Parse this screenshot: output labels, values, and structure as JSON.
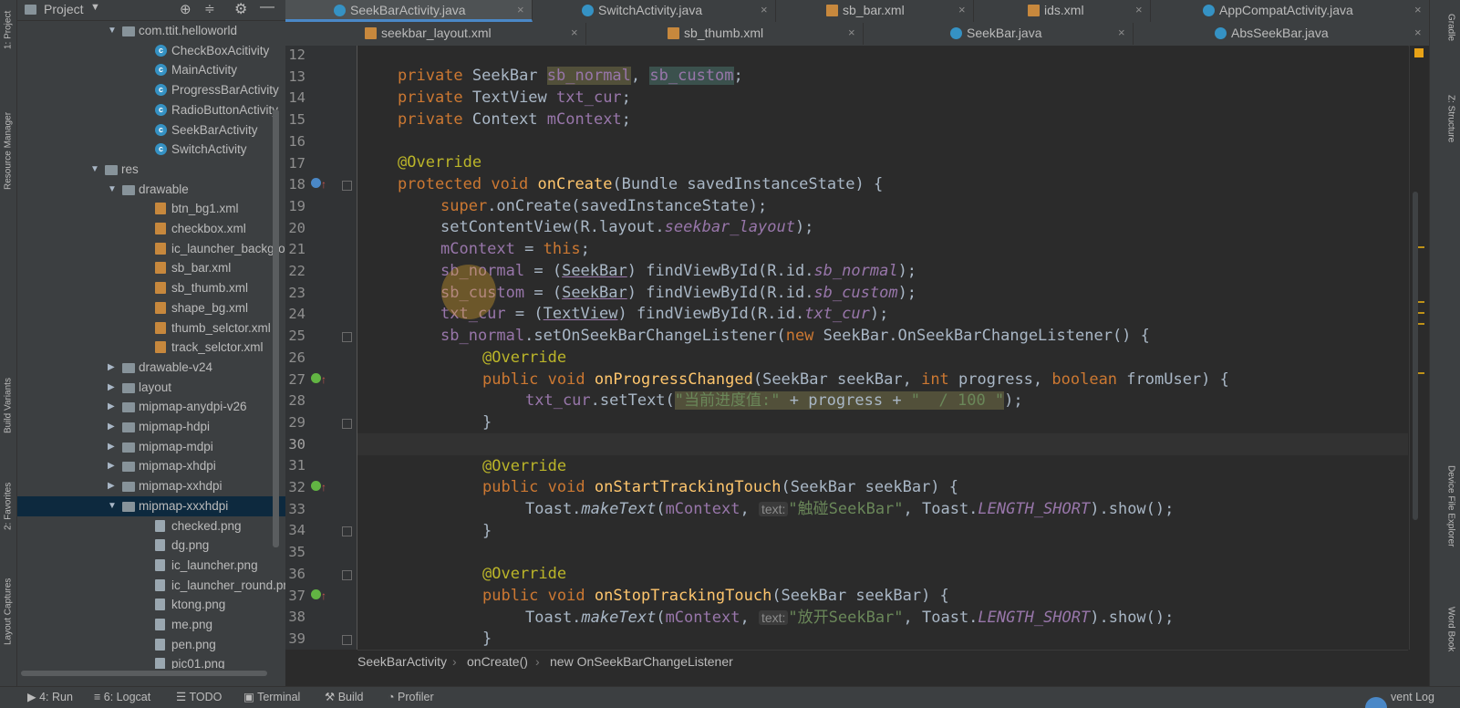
{
  "left_stripe": {
    "project_tab": "1: Project",
    "resource_manager": "Resource Manager",
    "build_variants": "Build Variants",
    "favorites": "2: Favorites",
    "layout_captures": "Layout Captures"
  },
  "project_panel": {
    "title": "Project",
    "tree": [
      {
        "label": "com.ttit.helloworld",
        "type": "folder",
        "arrow": "▼",
        "indent": 0
      },
      {
        "label": "CheckBoxAcitivity",
        "type": "class",
        "arrow": "",
        "indent": 1
      },
      {
        "label": "MainActivity",
        "type": "class",
        "arrow": "",
        "indent": 1
      },
      {
        "label": "ProgressBarActivity",
        "type": "class",
        "arrow": "",
        "indent": 1
      },
      {
        "label": "RadioButtonActivity",
        "type": "class",
        "arrow": "",
        "indent": 1
      },
      {
        "label": "SeekBarActivity",
        "type": "class",
        "arrow": "",
        "indent": 1
      },
      {
        "label": "SwitchActivity",
        "type": "class",
        "arrow": "",
        "indent": 1
      },
      {
        "label": "res",
        "type": "folder",
        "arrow": "▼",
        "indent": -1
      },
      {
        "label": "drawable",
        "type": "folder",
        "arrow": "▼",
        "indent": 0
      },
      {
        "label": "btn_bg1.xml",
        "type": "xml",
        "arrow": "",
        "indent": 1
      },
      {
        "label": "checkbox.xml",
        "type": "xml",
        "arrow": "",
        "indent": 1
      },
      {
        "label": "ic_launcher_backgrou",
        "type": "xml",
        "arrow": "",
        "indent": 1
      },
      {
        "label": "sb_bar.xml",
        "type": "xml",
        "arrow": "",
        "indent": 1
      },
      {
        "label": "sb_thumb.xml",
        "type": "xml",
        "arrow": "",
        "indent": 1
      },
      {
        "label": "shape_bg.xml",
        "type": "xml",
        "arrow": "",
        "indent": 1
      },
      {
        "label": "thumb_selctor.xml",
        "type": "xml",
        "arrow": "",
        "indent": 1
      },
      {
        "label": "track_selctor.xml",
        "type": "xml",
        "arrow": "",
        "indent": 1
      },
      {
        "label": "drawable-v24",
        "type": "folder",
        "arrow": "▶",
        "indent": 0
      },
      {
        "label": "layout",
        "type": "folder",
        "arrow": "▶",
        "indent": 0
      },
      {
        "label": "mipmap-anydpi-v26",
        "type": "folder",
        "arrow": "▶",
        "indent": 0
      },
      {
        "label": "mipmap-hdpi",
        "type": "folder",
        "arrow": "▶",
        "indent": 0
      },
      {
        "label": "mipmap-mdpi",
        "type": "folder",
        "arrow": "▶",
        "indent": 0
      },
      {
        "label": "mipmap-xhdpi",
        "type": "folder",
        "arrow": "▶",
        "indent": 0
      },
      {
        "label": "mipmap-xxhdpi",
        "type": "folder",
        "arrow": "▶",
        "indent": 0
      },
      {
        "label": "mipmap-xxxhdpi",
        "type": "folder",
        "arrow": "▼",
        "indent": 0,
        "selected": true
      },
      {
        "label": "checked.png",
        "type": "png",
        "arrow": "",
        "indent": 1
      },
      {
        "label": "dg.png",
        "type": "png",
        "arrow": "",
        "indent": 1
      },
      {
        "label": "ic_launcher.png",
        "type": "png",
        "arrow": "",
        "indent": 1
      },
      {
        "label": "ic_launcher_round.png",
        "type": "png",
        "arrow": "",
        "indent": 1
      },
      {
        "label": "ktong.png",
        "type": "png",
        "arrow": "",
        "indent": 1
      },
      {
        "label": "me.png",
        "type": "png",
        "arrow": "",
        "indent": 1
      },
      {
        "label": "pen.png",
        "type": "png",
        "arrow": "",
        "indent": 1
      },
      {
        "label": "pic01.png",
        "type": "png",
        "arrow": "",
        "indent": 1
      }
    ]
  },
  "tabs_row1": [
    {
      "label": "SeekBarActivity.java",
      "icon": "class",
      "active": true
    },
    {
      "label": "SwitchActivity.java",
      "icon": "class"
    },
    {
      "label": "sb_bar.xml",
      "icon": "xml"
    },
    {
      "label": "ids.xml",
      "icon": "xml"
    },
    {
      "label": "AppCompatActivity.java",
      "icon": "class"
    }
  ],
  "tabs_row2": [
    {
      "label": "seekbar_layout.xml",
      "icon": "xml"
    },
    {
      "label": "sb_thumb.xml",
      "icon": "xml"
    },
    {
      "label": "SeekBar.java",
      "icon": "class"
    },
    {
      "label": "AbsSeekBar.java",
      "icon": "class"
    }
  ],
  "editor": {
    "line_numbers": [
      "12",
      "13",
      "14",
      "15",
      "16",
      "17",
      "18",
      "19",
      "20",
      "21",
      "22",
      "23",
      "24",
      "25",
      "26",
      "27",
      "28",
      "29",
      "30",
      "31",
      "32",
      "33",
      "34",
      "35",
      "36",
      "37",
      "38",
      "39"
    ],
    "caret_line": "30"
  },
  "right_stripe": {
    "gradle": "Gradle",
    "structure": "Z: Structure",
    "device_file_explorer": "Device File Explorer",
    "word_book": "Word Book"
  },
  "breadcrumb": [
    "SeekBarActivity",
    "onCreate()",
    "new OnSeekBarChangeListener"
  ],
  "bottom_bar": {
    "run": "4: Run",
    "logcat": "6: Logcat",
    "todo": "TODO",
    "terminal": "Terminal",
    "build": "Build",
    "profiler": "Profiler",
    "event_log": "vent Log"
  },
  "colors": {
    "keyword": "#cc7832",
    "annotation": "#bbb529",
    "method": "#ffc66d",
    "field": "#9876aa",
    "string": "#6a8759",
    "selection": "#0d293e",
    "tab_accent": "#4a88c7"
  }
}
